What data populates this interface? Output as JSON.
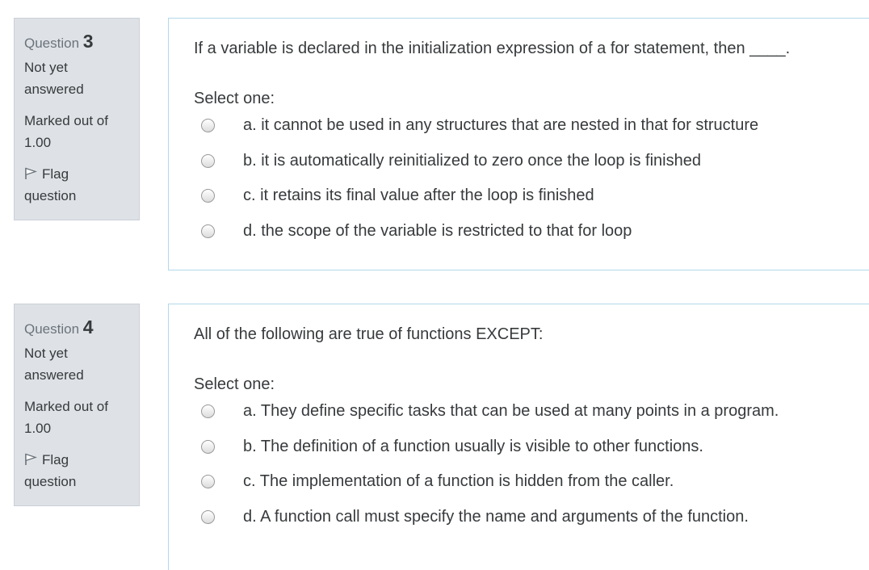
{
  "questions": [
    {
      "number_label": "Question",
      "number": "3",
      "state": "Not yet answered",
      "grade": "Marked out of 1.00",
      "flag_label": "Flag question",
      "text": "If a variable is declared in the initialization expression of a for statement, then ____.",
      "select_label": "Select one:",
      "answers": [
        "a. it cannot be used in any structures that are nested in that for structure",
        "b. it is automatically reinitialized to zero once the loop is finished",
        "c. it retains its final value after the loop is finished",
        "d. the scope of the variable is restricted to that for loop"
      ]
    },
    {
      "number_label": "Question",
      "number": "4",
      "state": "Not yet answered",
      "grade": "Marked out of 1.00",
      "flag_label": "Flag question",
      "text": "All of the following are true of functions EXCEPT:",
      "select_label": "Select one:",
      "answers": [
        "a. They define specific tasks that can be used at many points in a program.",
        "b. The definition of a function usually is visible to other functions.",
        "c. The implementation of a function is hidden from the caller.",
        "d. A function call must specify the name and arguments of the function."
      ]
    }
  ],
  "icons": {
    "flag": "flag-icon",
    "radio": "radio-unchecked-icon"
  },
  "colors": {
    "info_background": "#dee2e6",
    "content_border": "#b3d8ea",
    "text": "#373a3c",
    "muted_text": "#6a737b"
  }
}
